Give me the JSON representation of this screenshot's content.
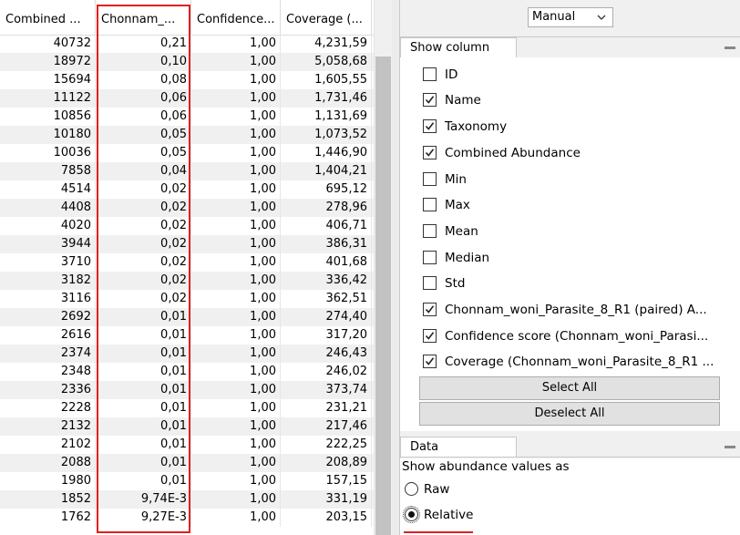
{
  "table": {
    "headers": [
      "Combined ...",
      "Chonnam_...",
      "Confidence...",
      "Coverage (..."
    ],
    "rows": [
      [
        "40732",
        "0,21",
        "1,00",
        "4,231,59"
      ],
      [
        "18972",
        "0,10",
        "1,00",
        "5,058,68"
      ],
      [
        "15694",
        "0,08",
        "1,00",
        "1,605,55"
      ],
      [
        "11122",
        "0,06",
        "1,00",
        "1,731,46"
      ],
      [
        "10856",
        "0,06",
        "1,00",
        "1,131,69"
      ],
      [
        "10180",
        "0,05",
        "1,00",
        "1,073,52"
      ],
      [
        "10036",
        "0,05",
        "1,00",
        "1,446,90"
      ],
      [
        "7858",
        "0,04",
        "1,00",
        "1,404,21"
      ],
      [
        "4514",
        "0,02",
        "1,00",
        "695,12"
      ],
      [
        "4408",
        "0,02",
        "1,00",
        "278,96"
      ],
      [
        "4020",
        "0,02",
        "1,00",
        "406,71"
      ],
      [
        "3944",
        "0,02",
        "1,00",
        "386,31"
      ],
      [
        "3710",
        "0,02",
        "1,00",
        "401,68"
      ],
      [
        "3182",
        "0,02",
        "1,00",
        "336,42"
      ],
      [
        "3116",
        "0,02",
        "1,00",
        "362,51"
      ],
      [
        "2692",
        "0,01",
        "1,00",
        "274,40"
      ],
      [
        "2616",
        "0,01",
        "1,00",
        "317,20"
      ],
      [
        "2374",
        "0,01",
        "1,00",
        "246,43"
      ],
      [
        "2348",
        "0,01",
        "1,00",
        "246,02"
      ],
      [
        "2336",
        "0,01",
        "1,00",
        "373,74"
      ],
      [
        "2228",
        "0,01",
        "1,00",
        "231,21"
      ],
      [
        "2132",
        "0,01",
        "1,00",
        "217,46"
      ],
      [
        "2102",
        "0,01",
        "1,00",
        "222,25"
      ],
      [
        "2088",
        "0,01",
        "1,00",
        "208,89"
      ],
      [
        "1980",
        "0,01",
        "1,00",
        "157,15"
      ],
      [
        "1852",
        "9,74E-3",
        "1,00",
        "331,19"
      ],
      [
        "1762",
        "9,27E-3",
        "1,00",
        "203,15"
      ]
    ]
  },
  "top_select": {
    "value": "Manual"
  },
  "show_column": {
    "tab_label": "Show column",
    "items": [
      {
        "label": "ID",
        "checked": false
      },
      {
        "label": "Name",
        "checked": true
      },
      {
        "label": "Taxonomy",
        "checked": true
      },
      {
        "label": "Combined Abundance",
        "checked": true
      },
      {
        "label": "Min",
        "checked": false
      },
      {
        "label": "Max",
        "checked": false
      },
      {
        "label": "Mean",
        "checked": false
      },
      {
        "label": "Median",
        "checked": false
      },
      {
        "label": "Std",
        "checked": false
      },
      {
        "label": "Chonnam_woni_Parasite_8_R1 (paired) A...",
        "checked": true
      },
      {
        "label": "Confidence score (Chonnam_woni_Parasi...",
        "checked": true
      },
      {
        "label": "Coverage (Chonnam_woni_Parasite_8_R1 ...",
        "checked": true
      }
    ],
    "select_all_label": "Select All",
    "deselect_all_label": "Deselect All"
  },
  "data_panel": {
    "tab_label": "Data",
    "prompt": "Show abundance values as",
    "options": [
      {
        "label": "Raw",
        "selected": false
      },
      {
        "label": "Relative",
        "selected": true
      }
    ]
  },
  "colors": {
    "highlight": "#e02020",
    "panel_bg": "#f0f0f0",
    "row_alt": "#f0f0f0"
  }
}
